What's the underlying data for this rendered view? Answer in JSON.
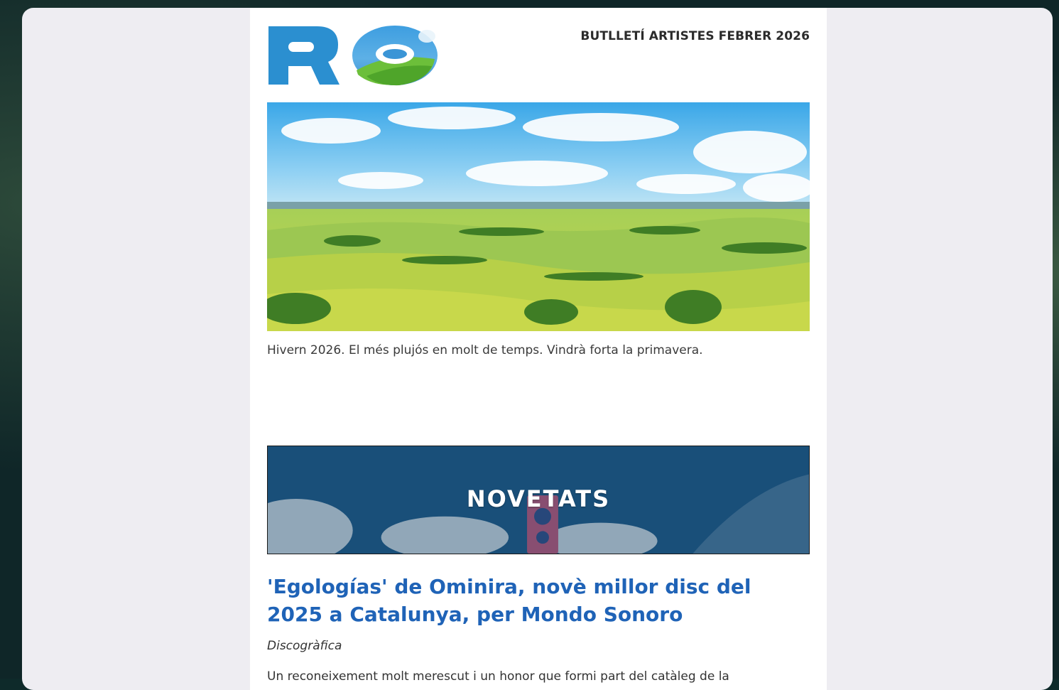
{
  "newsletter": {
    "brand_mark": "RO",
    "issue_title": "BUTLLETÍ ARTISTES FEBRER 2026",
    "hero_caption": "Hivern 2026. El més plujós en molt de temps. Vindrà forta la primavera.",
    "section_banner": "NOVETATS",
    "article": {
      "headline": "'Egologías' de Ominira, novè millor disc del 2025 a Catalunya, per Mondo Sonoro",
      "byline": "Discogràfica",
      "teaser": "Un reconeixement molt merescut i un honor que formi part del catàleg de la"
    }
  },
  "colors": {
    "headline": "#1f63b7",
    "logo_blue": "#2b8fd0",
    "frame": "#eeedf2",
    "outer": "#0f2628"
  },
  "icons": {
    "logo": "ro-logo-icon",
    "hero": "landscape-image",
    "banner": "speaker-sky-banner"
  }
}
